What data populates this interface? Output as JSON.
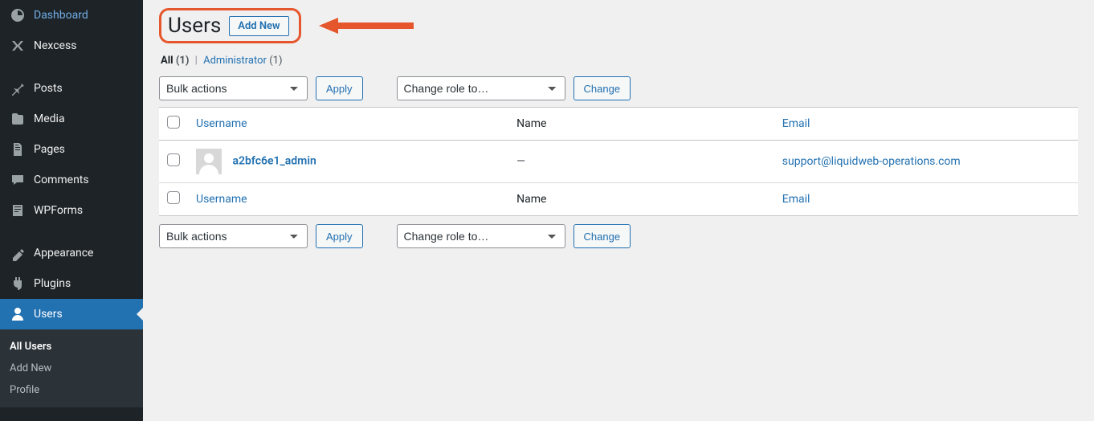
{
  "sidebar": {
    "items": [
      {
        "label": "Dashboard",
        "icon": "dashboard"
      },
      {
        "label": "Nexcess",
        "icon": "nexcess"
      },
      {
        "sep": true
      },
      {
        "label": "Posts",
        "icon": "pin"
      },
      {
        "label": "Media",
        "icon": "media"
      },
      {
        "label": "Pages",
        "icon": "pages"
      },
      {
        "label": "Comments",
        "icon": "comments"
      },
      {
        "label": "WPForms",
        "icon": "wpforms"
      },
      {
        "sep": true
      },
      {
        "label": "Appearance",
        "icon": "appearance"
      },
      {
        "label": "Plugins",
        "icon": "plugins"
      },
      {
        "label": "Users",
        "icon": "users",
        "current": true
      }
    ],
    "submenu": [
      {
        "label": "All Users",
        "current": true
      },
      {
        "label": "Add New"
      },
      {
        "label": "Profile"
      }
    ]
  },
  "page": {
    "title": "Users",
    "add_new": "Add New"
  },
  "filters": {
    "all_label": "All",
    "all_count": "(1)",
    "admin_label": "Administrator",
    "admin_count": "(1)",
    "sep": "|"
  },
  "actions": {
    "bulk_placeholder": "Bulk actions",
    "apply": "Apply",
    "role_placeholder": "Change role to…",
    "change": "Change"
  },
  "table": {
    "col_username": "Username",
    "col_name": "Name",
    "col_email": "Email",
    "rows": [
      {
        "username": "a2bfc6e1_admin",
        "name": "—",
        "email": "support@liquidweb-operations.com"
      }
    ]
  }
}
